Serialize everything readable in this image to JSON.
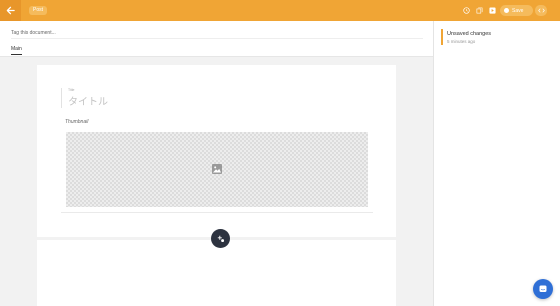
{
  "toolbar": {
    "doc_type": "Post",
    "save_label": "Save",
    "accent_color": "#f0a535"
  },
  "editor": {
    "tag_placeholder": "Tag this document...",
    "tabs": [
      {
        "label": "Main",
        "active": true
      }
    ]
  },
  "document": {
    "title_label": "Title",
    "title_placeholder": "タイトル",
    "thumbnail_label": "Thumbnail"
  },
  "status": {
    "title": "Unsaved changes",
    "time": "5 minutes ago"
  },
  "icons": [
    "arrow-left-icon",
    "clock-icon",
    "copy-icon",
    "play-icon",
    "globe-icon",
    "code-icon",
    "image-icon",
    "plus-icon",
    "chat-icon"
  ]
}
